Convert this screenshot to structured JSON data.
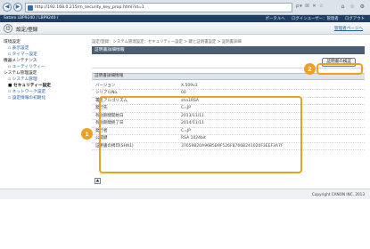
{
  "browser": {
    "url": "http://192.168.0.215/m_security_key_prop.html?id=1",
    "tools": "ρ▾ ☒ ✕ ☆",
    "window_icons": "⌂ ☆ ⚙"
  },
  "topbar": {
    "crumb": "Sataro  LBP9240 / LBP9240 /",
    "links": [
      "ポータルへ",
      "ログインユーザー：管理者",
      "ログアウト"
    ]
  },
  "title": {
    "text": "設定/登録",
    "portal_link": "管理者ページへ"
  },
  "sidebar": {
    "items": [
      {
        "label": "環境設定",
        "kind": "head"
      },
      {
        "label": "▫ 表示設定",
        "kind": "sub"
      },
      {
        "label": "▫ タイマー設定",
        "kind": "sub"
      },
      {
        "label": "機器メンテナンス",
        "kind": "head"
      },
      {
        "label": "▫ ユーティリティー",
        "kind": "sub"
      },
      {
        "label": "システム管理設定",
        "kind": "head"
      },
      {
        "label": "▫ システム管理",
        "kind": "sub"
      },
      {
        "label": "■ セキュリティー設定",
        "kind": "sub-active"
      },
      {
        "label": "▫ ネットワーク設定",
        "kind": "sub"
      },
      {
        "label": "▫ 設定情報の初期化",
        "kind": "sub"
      }
    ]
  },
  "content": {
    "path": "設定/登録：システム管理設定：セキュリティー設定 > 鍵と証明書設定 > 証明書詳細",
    "panel_title": "証明書詳細情報",
    "detail_button": "証明書の検証",
    "section_title": "証明書詳細情報",
    "rows": [
      {
        "key": "バージョン",
        "value": "X.509v3"
      },
      {
        "key": "シリアルNo.",
        "value": "00"
      },
      {
        "key": "署名アルゴリズム",
        "value": "sha1RSA"
      },
      {
        "key": "発行先",
        "value": "C=JP"
      },
      {
        "key": "有効期間開始日",
        "value": "2013/11/11"
      },
      {
        "key": "有効期間終了日",
        "value": "2014/11/11"
      },
      {
        "key": "発行者",
        "value": "C=JP"
      },
      {
        "key": "公開鍵",
        "value": "RSA 1024bit"
      },
      {
        "key": "証明書の拇印(SHA1)",
        "value": "37659B20A96B5B9F526F8766B241020F3EEF3A7F"
      }
    ]
  },
  "callouts": {
    "one": "1",
    "two": "2"
  },
  "footer": {
    "copyright": "Copyright CANON INC. 2013"
  },
  "colors": {
    "highlight": "#f0a020",
    "header": "#1f3e63",
    "panel": "#4a5d73"
  }
}
